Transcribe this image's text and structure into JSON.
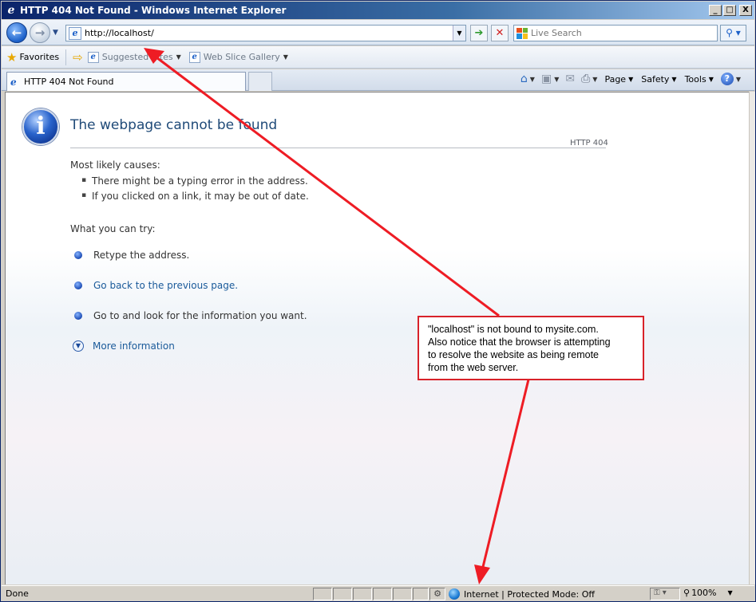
{
  "window": {
    "title": "HTTP 404 Not Found - Windows Internet Explorer",
    "controls": {
      "minimize": "_",
      "maximize": "□",
      "close": "X"
    }
  },
  "address_bar": {
    "url": "http://localhost/",
    "search_placeholder": "Live Search"
  },
  "favorites_bar": {
    "favorites_label": "Favorites",
    "items": [
      {
        "label": "Suggested Sites",
        "icon": "ie-page-icon"
      },
      {
        "label": "Web Slice Gallery",
        "icon": "ie-page-icon"
      }
    ]
  },
  "tabs": [
    {
      "label": "HTTP 404 Not Found"
    }
  ],
  "command_bar": {
    "home_icon": "home-icon",
    "feeds_icon": "feeds-icon",
    "mail_icon": "mail-icon",
    "print_icon": "print-icon",
    "page_label": "Page",
    "safety_label": "Safety",
    "tools_label": "Tools",
    "help_icon": "help-icon"
  },
  "error_page": {
    "title": "The webpage cannot be found",
    "code": "HTTP 404",
    "causes_heading": "Most likely causes:",
    "causes": [
      "There might be a typing error in the address.",
      "If you clicked on a link, it may be out of date."
    ],
    "try_heading": "What you can try:",
    "actions": [
      {
        "label": "Retype the address.",
        "link": false
      },
      {
        "label": "Go back to the previous page.",
        "link": true
      },
      {
        "label": "Go to  and look for the information you want.",
        "link": false
      }
    ],
    "more_info": "More information"
  },
  "annotation": {
    "lines": [
      "\"localhost\" is not bound to mysite.com.",
      "Also notice that the browser is attempting",
      "to resolve the website as being remote",
      "from the web server."
    ],
    "color": "#d8222a"
  },
  "status_bar": {
    "status": "Done",
    "zone": "Internet | Protected Mode: Off",
    "zoom": "100%"
  }
}
